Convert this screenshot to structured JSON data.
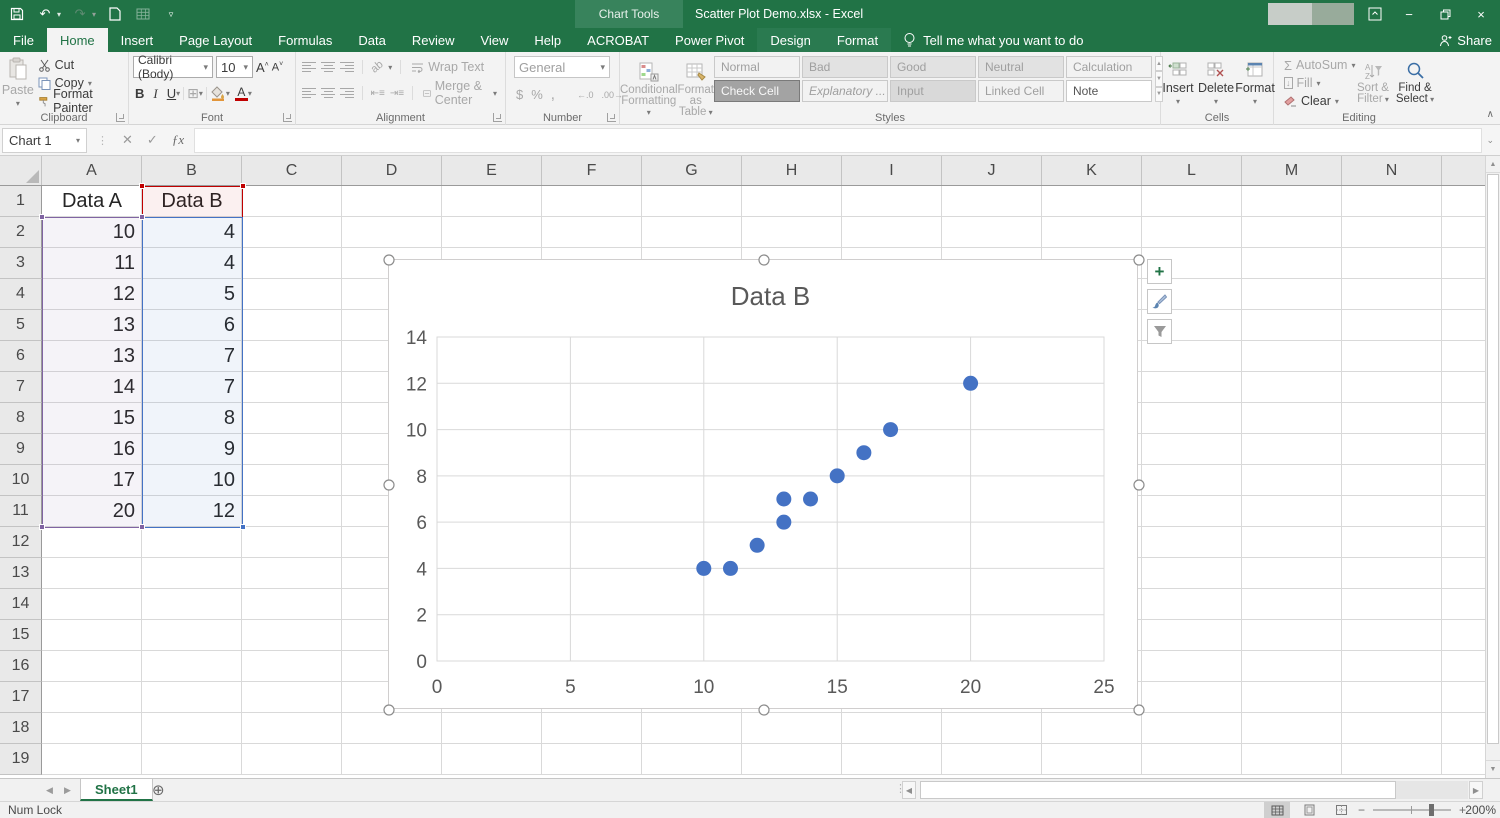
{
  "titlebar": {
    "contextual_label": "Chart Tools",
    "title": "Scatter Plot Demo.xlsx - Excel"
  },
  "ribbon_tabs": {
    "items": [
      {
        "label": "File",
        "active": false,
        "contextual": false
      },
      {
        "label": "Home",
        "active": true,
        "contextual": false
      },
      {
        "label": "Insert",
        "active": false,
        "contextual": false
      },
      {
        "label": "Page Layout",
        "active": false,
        "contextual": false
      },
      {
        "label": "Formulas",
        "active": false,
        "contextual": false
      },
      {
        "label": "Data",
        "active": false,
        "contextual": false
      },
      {
        "label": "Review",
        "active": false,
        "contextual": false
      },
      {
        "label": "View",
        "active": false,
        "contextual": false
      },
      {
        "label": "Help",
        "active": false,
        "contextual": false
      },
      {
        "label": "ACROBAT",
        "active": false,
        "contextual": false
      },
      {
        "label": "Power Pivot",
        "active": false,
        "contextual": false
      },
      {
        "label": "Design",
        "active": false,
        "contextual": true
      },
      {
        "label": "Format",
        "active": false,
        "contextual": true
      }
    ],
    "tell_me": "Tell me what you want to do",
    "share": "Share"
  },
  "ribbon": {
    "clipboard": {
      "title": "Clipboard",
      "paste": "Paste",
      "cut": "Cut",
      "copy": "Copy",
      "format_painter": "Format Painter"
    },
    "font": {
      "title": "Font",
      "font_name": "Calibri (Body)",
      "font_size": "10",
      "bold": "B",
      "italic": "I",
      "underline": "U"
    },
    "alignment": {
      "title": "Alignment",
      "wrap_text": "Wrap Text",
      "merge_center": "Merge & Center"
    },
    "number": {
      "title": "Number",
      "format": "General",
      "currency": "$",
      "percent": "%",
      "comma": ","
    },
    "styles": {
      "title": "Styles",
      "conditional_1": "Conditional",
      "conditional_2": "Formatting",
      "format_table_1": "Format as",
      "format_table_2": "Table",
      "chips": [
        {
          "label": "Normal",
          "kind": "normal"
        },
        {
          "label": "Bad",
          "kind": "bad"
        },
        {
          "label": "Good",
          "kind": "good"
        },
        {
          "label": "Neutral",
          "kind": "neutral"
        },
        {
          "label": "Calculation",
          "kind": "calculation"
        },
        {
          "label": "Check Cell",
          "kind": "check"
        },
        {
          "label": "Explanatory ...",
          "kind": "explanatory"
        },
        {
          "label": "Input",
          "kind": "input"
        },
        {
          "label": "Linked Cell",
          "kind": "linked"
        },
        {
          "label": "Note",
          "kind": "note"
        }
      ]
    },
    "cells": {
      "title": "Cells",
      "insert": "Insert",
      "delete": "Delete",
      "format": "Format"
    },
    "editing": {
      "title": "Editing",
      "autosum": "AutoSum",
      "fill": "Fill",
      "clear": "Clear",
      "sort_1": "Sort &",
      "sort_2": "Filter",
      "find_1": "Find &",
      "find_2": "Select"
    }
  },
  "formula_bar": {
    "name_box": "Chart 1",
    "fx": "ƒx"
  },
  "grid": {
    "columns": [
      "A",
      "B",
      "C",
      "D",
      "E",
      "F",
      "G",
      "H",
      "I",
      "J",
      "K",
      "L",
      "M",
      "N"
    ],
    "row_count": 19
  },
  "sheet_data": {
    "header_a": "Data A",
    "header_b": "Data B",
    "rows": [
      [
        10,
        4
      ],
      [
        11,
        4
      ],
      [
        12,
        5
      ],
      [
        13,
        6
      ],
      [
        13,
        7
      ],
      [
        14,
        7
      ],
      [
        15,
        8
      ],
      [
        16,
        9
      ],
      [
        17,
        10
      ],
      [
        20,
        12
      ]
    ]
  },
  "chart_data": {
    "type": "scatter",
    "title": "Data B",
    "x": [
      10,
      11,
      12,
      13,
      13,
      14,
      15,
      16,
      17,
      20
    ],
    "y": [
      4,
      4,
      5,
      6,
      7,
      7,
      8,
      9,
      10,
      12
    ],
    "xlim": [
      0,
      25
    ],
    "ylim": [
      0,
      14
    ],
    "x_ticks": [
      0,
      5,
      10,
      15,
      20,
      25
    ],
    "y_ticks": [
      0,
      2,
      4,
      6,
      8,
      10,
      12,
      14
    ],
    "xlabel": "",
    "ylabel": "",
    "grid": true,
    "legend": false,
    "marker_color": "#4472C4"
  },
  "sheet_tabs": {
    "active": "Sheet1"
  },
  "status_bar": {
    "left": "Num Lock",
    "zoom": "200%"
  },
  "colors": {
    "excel_green": "#217346",
    "contextual_green": "#38835C",
    "accent_blue": "#4472C4",
    "series_purple": "#8064A2",
    "range_red": "#C00000",
    "chart_text": "#595959"
  }
}
